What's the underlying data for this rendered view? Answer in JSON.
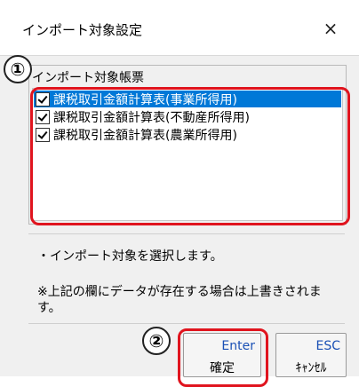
{
  "window": {
    "title": "インポート対象設定",
    "close_glyph": "×"
  },
  "group": {
    "title": "インポート対象帳票",
    "items": [
      {
        "label": "課税取引金額計算表(事業所得用)",
        "checked": true,
        "selected": true
      },
      {
        "label": "課税取引金額計算表(不動産所得用)",
        "checked": true,
        "selected": false
      },
      {
        "label": "課税取引金額計算表(農業所得用)",
        "checked": true,
        "selected": false
      }
    ]
  },
  "info": {
    "line1": "・インポート対象を選択します。",
    "line2": "※上記の欄にデータが存在する場合は上書きされます。"
  },
  "buttons": {
    "confirm": {
      "key": "Enter",
      "label": "確定"
    },
    "cancel": {
      "key": "ESC",
      "label": "ｷｬﾝｾﾙ"
    }
  },
  "annotations": {
    "marker1": "①",
    "marker2": "②",
    "highlight_color": "#e0141e"
  }
}
